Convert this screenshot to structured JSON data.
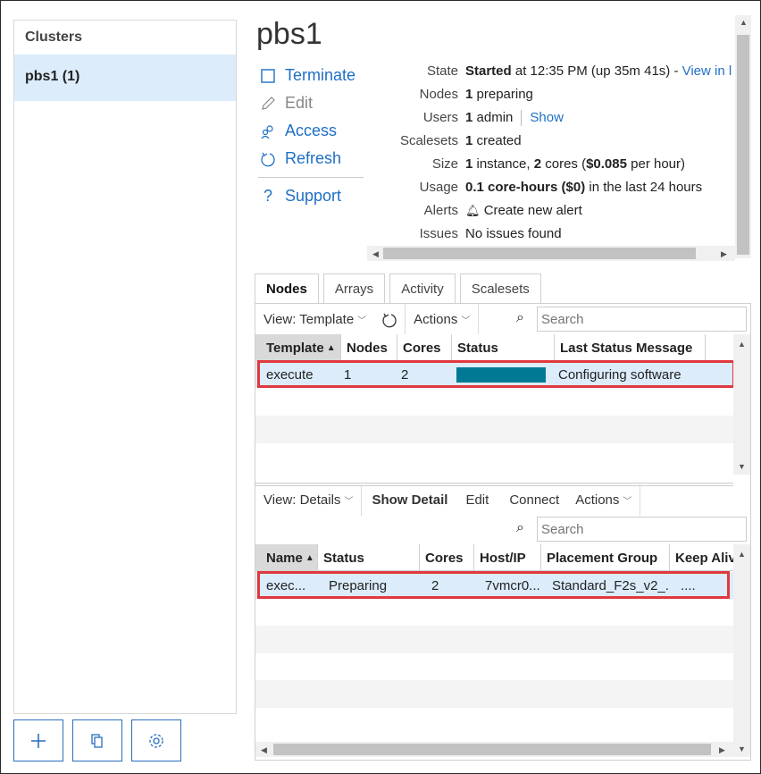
{
  "sidebar": {
    "header": "Clusters",
    "items": [
      {
        "label": "pbs1 (1)"
      }
    ]
  },
  "cluster": {
    "title": "pbs1"
  },
  "actions": {
    "terminate": "Terminate",
    "edit": "Edit",
    "access": "Access",
    "refresh": "Refresh",
    "support": "Support"
  },
  "info": {
    "state_label": "State",
    "state_value": "Started",
    "state_detail": " at 12:35 PM (up 35m 41s) - ",
    "state_link": "View in l",
    "nodes_label": "Nodes",
    "nodes_count": "1",
    "nodes_text": " preparing",
    "users_label": "Users",
    "users_count": "1",
    "users_text": " admin",
    "users_link": "Show",
    "scalesets_label": "Scalesets",
    "scalesets_count": "1",
    "scalesets_text": " created",
    "size_label": "Size",
    "size_instances": "1",
    "size_text1": " instance, ",
    "size_cores": "2",
    "size_text2": " cores (",
    "size_cost": "$0.085",
    "size_text3": " per hour)",
    "usage_label": "Usage",
    "usage_value": "0.1 core-hours ($0)",
    "usage_text": " in the last 24 hours",
    "alerts_label": "Alerts",
    "alerts_link": "Create new alert",
    "issues_label": "Issues",
    "issues_value": "No issues found"
  },
  "tabs": [
    {
      "label": "Nodes"
    },
    {
      "label": "Arrays"
    },
    {
      "label": "Activity"
    },
    {
      "label": "Scalesets"
    }
  ],
  "top_toolbar": {
    "view": "View: Template",
    "actions": "Actions",
    "search_placeholder": "Search"
  },
  "top_grid": {
    "columns": [
      "Template",
      "Nodes",
      "Cores",
      "Status",
      "Last Status Message"
    ],
    "rows": [
      {
        "template": "execute",
        "nodes": "1",
        "cores": "2",
        "status_progress": 1.0,
        "message": "Configuring software"
      }
    ]
  },
  "bottom_toolbar": {
    "view": "View: Details",
    "show_detail": "Show Detail",
    "edit": "Edit",
    "connect": "Connect",
    "actions": "Actions",
    "search_placeholder": "Search"
  },
  "bottom_grid": {
    "columns": [
      "Name",
      "Status",
      "Cores",
      "Host/IP",
      "Placement Group",
      "Keep Aliv"
    ],
    "rows": [
      {
        "name": "exec...",
        "status": "Preparing",
        "cores": "2",
        "host": "7vmcr0...",
        "placement": "Standard_F2s_v2_...",
        "keep_alive": "...."
      }
    ]
  },
  "colors": {
    "accent": "#1f6fc5",
    "selected_row": "#dcecfb",
    "highlight_border": "#e0383e",
    "status_bar": "#007a94"
  }
}
